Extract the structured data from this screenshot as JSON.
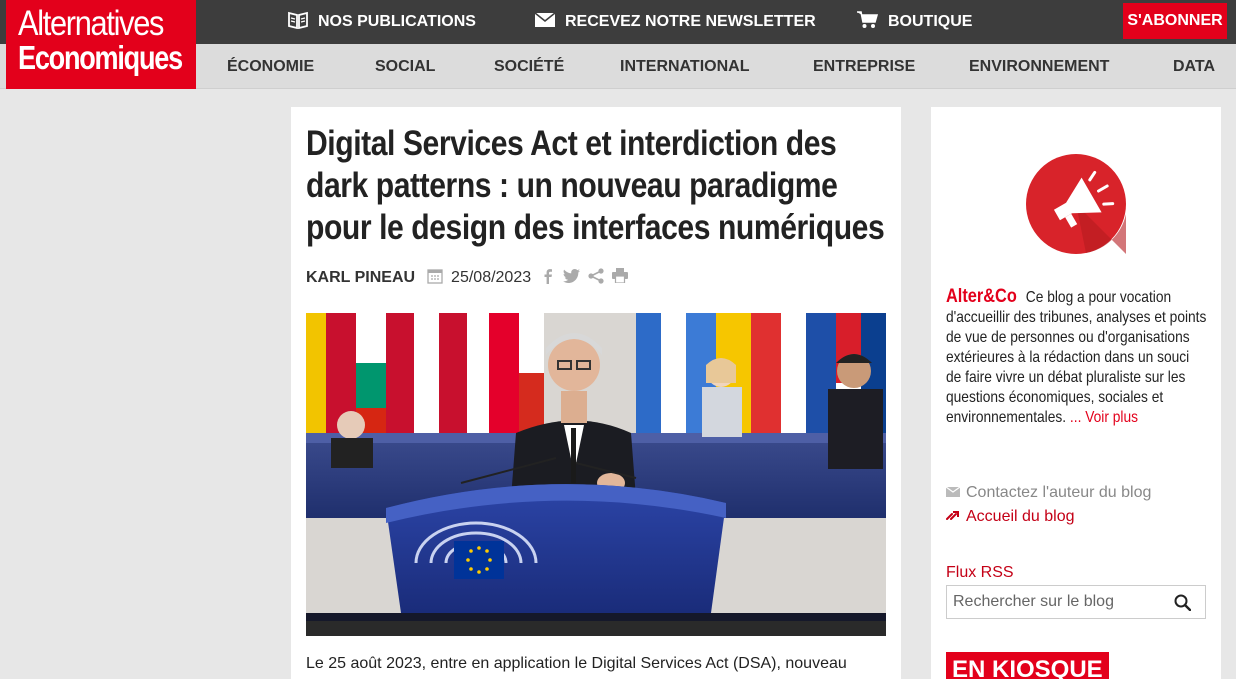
{
  "header": {
    "logo_line1": "Alternatives",
    "logo_line2": "Economiques",
    "top_links": [
      {
        "label": "NOS PUBLICATIONS",
        "icon": "book-icon"
      },
      {
        "label": "RECEVEZ NOTRE NEWSLETTER",
        "icon": "envelope-icon"
      },
      {
        "label": "BOUTIQUE",
        "icon": "cart-icon"
      }
    ],
    "subscribe_label": "S'ABONNER",
    "nav": [
      "ÉCONOMIE",
      "SOCIAL",
      "SOCIÉTÉ",
      "INTERNATIONAL",
      "ENTREPRISE",
      "ENVIRONNEMENT",
      "DATA"
    ]
  },
  "article": {
    "title_lines": [
      "Digital Services Act et interdiction des",
      "dark patterns : un nouveau paradigme",
      "pour le design des interfaces numériques"
    ],
    "author": "KARL PINEAU",
    "date": "25/08/2023",
    "share_icons": [
      "facebook-icon",
      "twitter-icon",
      "share-icon",
      "print-icon"
    ],
    "lead": "Le 25 août 2023, entre en application le Digital Services Act (DSA), nouveau"
  },
  "sidebar": {
    "blog_name": "Alter&Co",
    "blog_description": "Ce blog a pour vocation d'accueillir des tribunes, analyses et points de vue de personnes ou d'organisations extérieures à la rédaction dans un souci de faire vivre un débat pluraliste sur les questions économiques, sociales et environnementales.",
    "more_label": "... Voir plus",
    "contact_label": "Contactez l'auteur du blog",
    "home_label": "Accueil du blog",
    "rss_label": "Flux RSS",
    "search_placeholder": "Rechercher sur le blog",
    "kiosque_label": "EN KIOSQUE"
  },
  "colors": {
    "brand_red": "#e3001b",
    "topbar": "#3d3d3d",
    "navbar": "#dcdcdc",
    "page_bg": "#e7e7e7"
  }
}
